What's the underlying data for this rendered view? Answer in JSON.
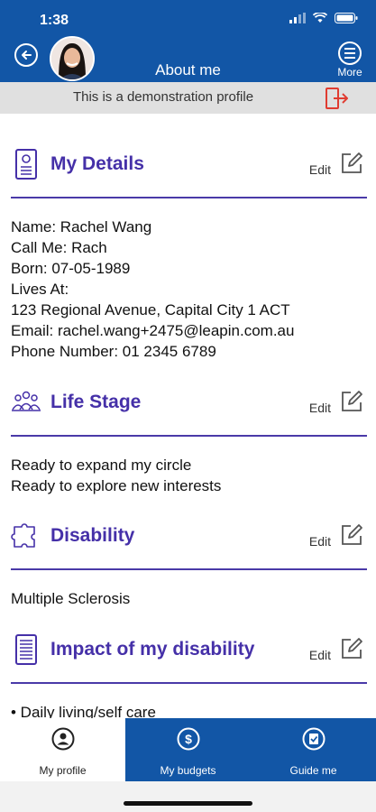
{
  "status_bar": {
    "time": "1:38"
  },
  "header": {
    "title": "About me",
    "more_label": "More"
  },
  "demo_banner": {
    "text": "This is a demonstration profile"
  },
  "sections": {
    "details": {
      "title": "My Details",
      "edit_label": "Edit",
      "lines": [
        "Name: Rachel Wang",
        "Call Me: Rach",
        "Born: 07-05-1989",
        "Lives At:",
        "123 Regional Avenue, Capital City 1 ACT",
        "Email: rachel.wang+2475@leapin.com.au",
        "Phone Number: 01 2345 6789"
      ]
    },
    "life_stage": {
      "title": "Life Stage",
      "edit_label": "Edit",
      "lines": [
        "Ready to expand my circle",
        "Ready to explore new interests"
      ]
    },
    "disability": {
      "title": "Disability",
      "edit_label": "Edit",
      "lines": [
        "Multiple Sclerosis"
      ]
    },
    "impact": {
      "title": "Impact of my disability",
      "edit_label": "Edit",
      "lines": [
        "• Daily living/self care"
      ]
    }
  },
  "bottom_nav": {
    "tabs": [
      {
        "label": "My profile",
        "icon": "person-icon",
        "active": true
      },
      {
        "label": "My budgets",
        "icon": "dollar-icon",
        "active": false
      },
      {
        "label": "Guide me",
        "icon": "checklist-icon",
        "active": false
      }
    ]
  },
  "colors": {
    "brand_blue": "#1256a6",
    "heading_purple": "#4530a8",
    "banner_gray": "#e0e0e0",
    "exit_red": "#e03c31"
  }
}
